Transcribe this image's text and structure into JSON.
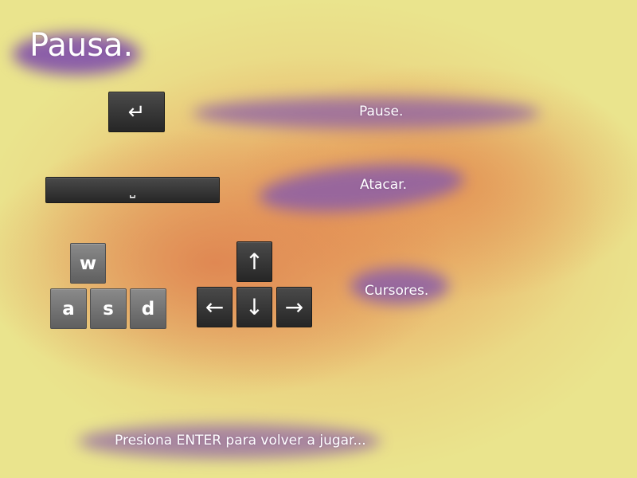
{
  "title": "Pausa.",
  "rows": [
    {
      "action": "Pause.",
      "keys": [
        "↵"
      ]
    },
    {
      "action": "Atacar.",
      "keys": [
        "⎵"
      ]
    },
    {
      "action": "Cursores.",
      "letter_keys": [
        "w",
        "a",
        "s",
        "d"
      ],
      "arrow_keys": [
        "↑",
        "←",
        "↓",
        "→"
      ]
    }
  ],
  "footer": "Presiona ENTER para volver a jugar...",
  "icons": {
    "enter": "enter-key-icon",
    "space": "space-key-icon",
    "arrows": [
      "arrow-up-icon",
      "arrow-left-icon",
      "arrow-down-icon",
      "arrow-right-icon"
    ]
  },
  "colors": {
    "background": "#eae48d",
    "warm": "#de804e",
    "highlight": "#8b5ea8",
    "key_dark": "#262626",
    "key_grey": "#6f6f6f",
    "text": "#ffffff"
  }
}
